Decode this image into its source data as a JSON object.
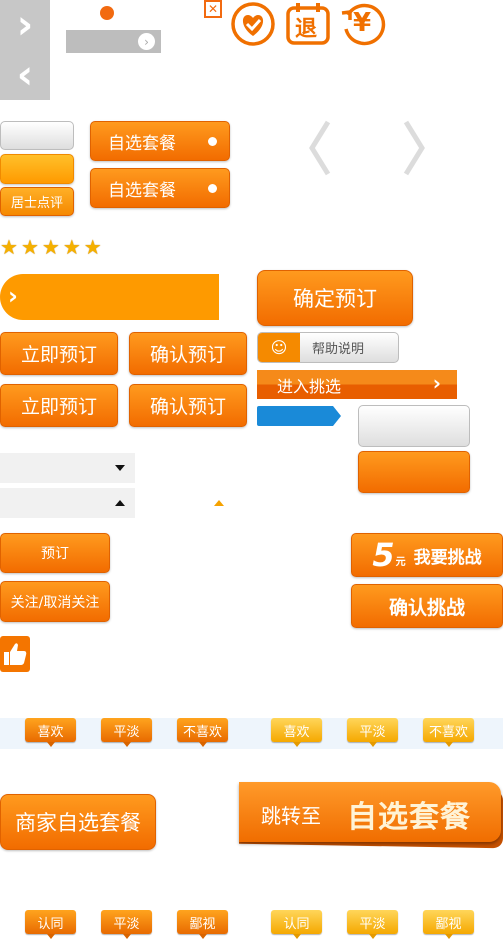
{
  "nav": {
    "next_glyph": "›",
    "prev_glyph": "‹"
  },
  "icons": {
    "close": "✕",
    "favorite": "heart-check-icon",
    "refund_label": "退",
    "yen_label": "¥"
  },
  "buttons": {
    "self_select_1": "自选套餐",
    "self_select_2": "自选套餐",
    "resident_review": "居士点评",
    "confirm_booking_big": "确定预订",
    "book_now_1": "立即预订",
    "confirm_1": "确认预订",
    "book_now_2": "立即预订",
    "confirm_2": "确认预订",
    "help": "帮助说明",
    "enter_select": "进入挑选",
    "book": "预订",
    "follow_toggle": "关注/取消关注",
    "challenge_prefix": "5",
    "challenge_unit": "元",
    "challenge_label": "我要挑战",
    "confirm_challenge": "确认挑战",
    "merchant_package": "商家自选套餐",
    "jump_to": "跳转至",
    "jump_target": "自选套餐"
  },
  "rating": {
    "stars": 5,
    "max": 5
  },
  "reactions_row1": {
    "left": [
      "喜欢",
      "平淡",
      "不喜欢"
    ],
    "right": [
      "喜欢",
      "平淡",
      "不喜欢"
    ]
  },
  "reactions_row2": {
    "left": [
      "认同",
      "平淡",
      "鄙视"
    ],
    "right": [
      "认同",
      "平淡",
      "鄙视"
    ]
  },
  "colors": {
    "accent": "#f47500",
    "gray": "#c8c8c8",
    "blue": "#1a8ad8"
  }
}
